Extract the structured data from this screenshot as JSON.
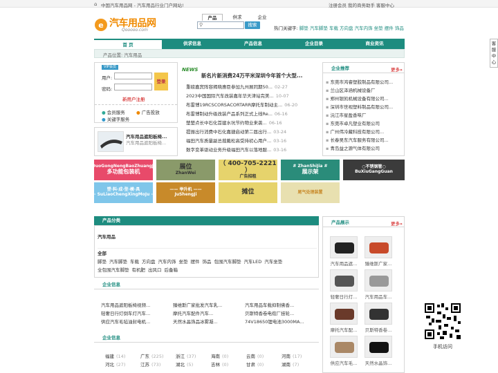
{
  "topbar": {
    "left": "中国汽车用品网 - 汽车用品行业门户网站!",
    "right": [
      "注册会员",
      "我的商务助手",
      "客服中心"
    ]
  },
  "logo": {
    "brand": "汽车用品网",
    "url_text": "Qooooo.com"
  },
  "search": {
    "tabs": [
      "产品",
      "供求",
      "企业"
    ],
    "placeholder": "",
    "button": "搜索",
    "hot_label": "热门关键字:",
    "hot": [
      "脚垫",
      "汽车脚垫",
      "车载",
      "方向盘",
      "汽车内饰",
      "坐垫",
      "摆件",
      "饰品"
    ]
  },
  "nav": [
    "首 页",
    "供求信息",
    "产品信息",
    "企业目录",
    "商业资讯"
  ],
  "breadcrumb": "产品位置: 汽车用品",
  "login": {
    "badge": "VIP会员",
    "user": "用户:",
    "pass": "密码:",
    "button": "登录",
    "register": "新用户注册",
    "services": [
      "会员服务",
      "广告投放",
      "关键字服务"
    ]
  },
  "promo": {
    "title": "汽车用品遮阳板椅...",
    "sub": "汽车用品遮阳板椅..."
  },
  "news": {
    "tag": "NEWS",
    "headline": "新名片新消费24万平米深圳今年首个大型...",
    "items": [
      {
        "t": "重磅嘉宾阵容揭晓惠臣参加九州展同期50...",
        "d": "02-27"
      },
      {
        "t": "2023中国国际汽车改装嘉年华天津站完美...",
        "d": "10-07"
      },
      {
        "t": "布雷博19RCSCORSACORTARR摩托车制动主...",
        "d": "06-20"
      },
      {
        "t": "布雷博制动升级改装产品系列正式上线Re...",
        "d": "06-16"
      },
      {
        "t": "楚楚点长中石化首建水坑节约物业来袭...",
        "d": "06-16"
      },
      {
        "t": "提振出行消费中石化嘉捷启动第二届出行...",
        "d": "03-24"
      },
      {
        "t": "福田汽车质量副总裁戴松高受持初心用户...",
        "d": "03-16"
      },
      {
        "t": "数字变革驱动业务升级福田汽车以落地服...",
        "d": "03-16"
      }
    ]
  },
  "companies": {
    "title": "企业推荐",
    "more": "更多»",
    "items": [
      "东莞市鸿睿塑胶制品有限公司...",
      "兰山区泽涵机械设备厂",
      "郑州银凯机械设备有限公司...",
      "深圳市世视塑料制品有限公司...",
      "沅江市星盈香味厂",
      "东莞市卓凡塑业有限公司",
      "广州伟冷藏科技有限公司...",
      "长春吴东汽车服务有限公司...",
      "青岛益之源气体有限公司"
    ]
  },
  "ads": [
    {
      "line1": "DuoGongNengBaoZhuangJi",
      "line2": "多功能包装机"
    },
    {
      "line1": "展位",
      "line2": "ZhanWei"
    },
    {
      "line1": "（ 400-705-2221 ）",
      "line2": "广告招租"
    },
    {
      "line1": "# ZhanShiJia #",
      "line2": "展示架"
    },
    {
      "line1": "○不锈钢管○",
      "line2": "BuXiuGangGuan"
    },
    {
      "line1": "塑·料·成·型·模·具",
      "line2": "- SuLiaoChengXingMoJu -"
    },
    {
      "line1": "—— 举升机 ——",
      "line2": "JuShengJi"
    },
    {
      "line1": "摊位",
      "line2": ""
    },
    {
      "line1": "尾气处理装置",
      "line2": ""
    }
  ],
  "categories": {
    "title": "产品分类",
    "main": "汽车用品",
    "sub_title": "全部",
    "items": [
      "脚垫",
      "汽车脚垫",
      "车载",
      "方向盘",
      "汽车内饰",
      "坐垫",
      "摆件",
      "饰品",
      "包围汽车脚垫",
      "汽车LED",
      "汽车坐垫",
      "全包围汽车脚垫",
      "有机肥",
      "出风口",
      "后备箱"
    ]
  },
  "biz": {
    "title": "企业信息",
    "items": [
      "汽车用品遮阳板椅视频...",
      "臻维斯广家批发汽车乳...",
      "汽车用品车载抑制佛香...",
      "轻奢日行灯倒车灯汽车...",
      "摩托汽车配件汽车...",
      "贝斯特香卷电缆厂挂轮...",
      "供应汽车毛毡油封电机...",
      "天然水晶饰品冰雾凝...",
      "74V18650锂电池3000MA..."
    ]
  },
  "regions": {
    "title": "企业信息",
    "rows": [
      [
        [
          "福建",
          "14"
        ],
        [
          "广东",
          "225"
        ],
        [
          "浙江",
          "37"
        ],
        [
          "海南",
          "0"
        ],
        [
          "云南",
          "0"
        ],
        [
          "河南",
          "17"
        ]
      ],
      [
        [
          "河北",
          "27"
        ],
        [
          "江苏",
          "73"
        ],
        [
          "湖北",
          "5"
        ],
        [
          "吉林",
          "0"
        ],
        [
          "甘肃",
          "0"
        ],
        [
          "湖南",
          "7"
        ]
      ]
    ]
  },
  "products": {
    "title": "产品展示",
    "more": "更多»",
    "items": [
      "汽车用品遮...",
      "臻维斯广家...",
      "轻奢日行灯...",
      "汽车用品车...",
      "摩托汽车配...",
      "贝斯特香卷...",
      "供应汽车毛...",
      "天然水晶饰..."
    ]
  },
  "qr": {
    "label": "手机访问"
  },
  "side": "客服中心"
}
